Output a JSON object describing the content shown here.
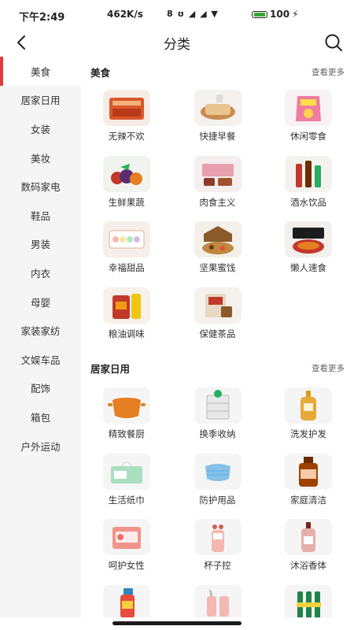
{
  "status_bar": {
    "time": "下午2:49",
    "network_speed": "462K/s",
    "icons": "8 ʊ ◢ ◢ ▼",
    "battery": "100"
  },
  "header": {
    "title": "分类",
    "back_icon": "chevron-left-icon",
    "search_icon": "search-icon"
  },
  "sidebar": {
    "active_index": 0,
    "accent_color": "#e33b3b",
    "items": [
      {
        "label": "美食"
      },
      {
        "label": "居家日用"
      },
      {
        "label": "女装"
      },
      {
        "label": "美妆"
      },
      {
        "label": "数码家电"
      },
      {
        "label": "鞋品"
      },
      {
        "label": "男装"
      },
      {
        "label": "内衣"
      },
      {
        "label": "母婴"
      },
      {
        "label": "家装家纺"
      },
      {
        "label": "文娱车品"
      },
      {
        "label": "配饰"
      },
      {
        "label": "箱包"
      },
      {
        "label": "户外运动"
      }
    ]
  },
  "sections": [
    {
      "title": "美食",
      "more": "查看更多",
      "items": [
        {
          "label": "无辣不欢",
          "icon": "spicy-snack"
        },
        {
          "label": "快捷早餐",
          "icon": "bread"
        },
        {
          "label": "休闲零食",
          "icon": "chips"
        },
        {
          "label": "生鲜果蔬",
          "icon": "fruits"
        },
        {
          "label": "肉食主义",
          "icon": "meat"
        },
        {
          "label": "酒水饮品",
          "icon": "drinks"
        },
        {
          "label": "幸福甜品",
          "icon": "macarons"
        },
        {
          "label": "坚果蜜饯",
          "icon": "nuts"
        },
        {
          "label": "懒人速食",
          "icon": "instant-noodles"
        },
        {
          "label": "粮油调味",
          "icon": "rice-oil"
        },
        {
          "label": "保健茶品",
          "icon": "tea"
        }
      ]
    },
    {
      "title": "居家日用",
      "more": "查看更多",
      "items": [
        {
          "label": "精致餐厨",
          "icon": "pot"
        },
        {
          "label": "换季收纳",
          "icon": "storage-drawer"
        },
        {
          "label": "洗发护发",
          "icon": "shampoo"
        },
        {
          "label": "生活纸巾",
          "icon": "tissue"
        },
        {
          "label": "防护用品",
          "icon": "mask"
        },
        {
          "label": "家庭清洁",
          "icon": "cleaner"
        },
        {
          "label": "呵护女性",
          "icon": "sanitary-pad"
        },
        {
          "label": "杯子控",
          "icon": "cup"
        },
        {
          "label": "沐浴香体",
          "icon": "body-wash"
        },
        {
          "label": "",
          "icon": "spray-bottle"
        },
        {
          "label": "",
          "icon": "cup-set"
        },
        {
          "label": "",
          "icon": "bottles"
        }
      ]
    }
  ]
}
